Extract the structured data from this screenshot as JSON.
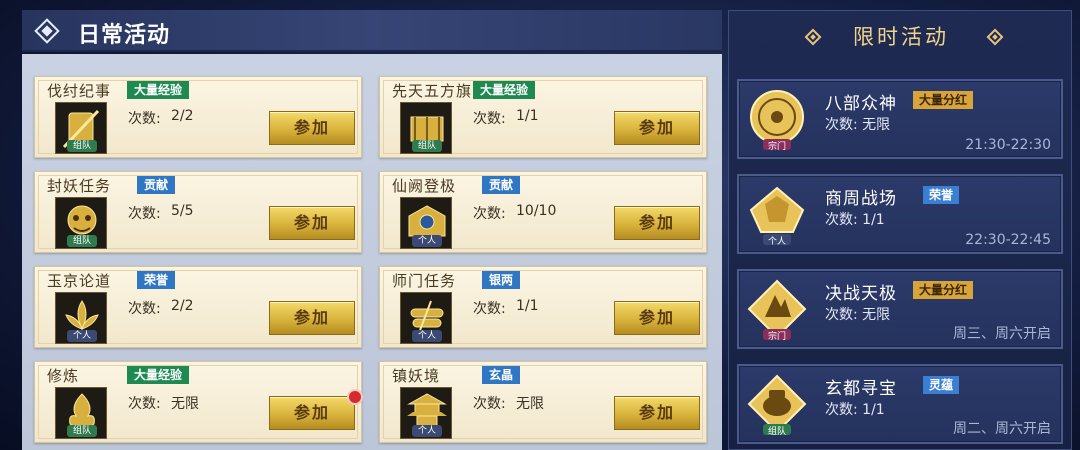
{
  "left_panel": {
    "title": "日常活动",
    "count_label": "次数:",
    "join_label": "参加",
    "activities": [
      {
        "name": "伐纣纪事",
        "tag": "大量经验",
        "tag_color": "green",
        "count": "2/2",
        "badge": "组队",
        "icon": "scroll-sword-icon"
      },
      {
        "name": "先天五方旗",
        "tag": "大量经验",
        "tag_color": "green",
        "count": "1/1",
        "badge": "组队",
        "icon": "flag-bundle-icon"
      },
      {
        "name": "封妖任务",
        "tag": "贡献",
        "tag_color": "blue",
        "count": "5/5",
        "badge": "组队",
        "icon": "demon-mask-icon"
      },
      {
        "name": "仙阙登极",
        "tag": "贡献",
        "tag_color": "blue",
        "count": "10/10",
        "badge": "个人",
        "icon": "celestial-gate-icon"
      },
      {
        "name": "玉京论道",
        "tag": "荣誉",
        "tag_color": "blue",
        "count": "2/2",
        "badge": "个人",
        "icon": "lotus-crest-icon"
      },
      {
        "name": "师门任务",
        "tag": "银两",
        "tag_color": "blue",
        "count": "1/1",
        "badge": "个人",
        "icon": "scroll-bundle-icon"
      },
      {
        "name": "修炼",
        "tag": "大量经验",
        "tag_color": "green",
        "count": "无限",
        "badge": "组队",
        "icon": "flame-crest-icon",
        "notify": true
      },
      {
        "name": "镇妖境",
        "tag": "玄晶",
        "tag_color": "blue",
        "count": "无限",
        "badge": "个人",
        "icon": "pagoda-icon"
      }
    ]
  },
  "right_panel": {
    "title": "限时活动",
    "count_label": "次数:",
    "events": [
      {
        "name": "八部众神",
        "tag": "大量分红",
        "tag_color": "gold",
        "count": "无限",
        "badge": "宗门",
        "time": "21:30-22:30",
        "icon": "round-crest-icon"
      },
      {
        "name": "商周战场",
        "tag": "荣誉",
        "tag_color": "blue",
        "count": "1/1",
        "badge": "个人",
        "time": "22:30-22:45",
        "icon": "battle-banner-icon"
      },
      {
        "name": "决战天极",
        "tag": "大量分红",
        "tag_color": "gold",
        "count": "无限",
        "badge": "宗门",
        "time": "周三、周六开启",
        "icon": "peak-crest-icon"
      },
      {
        "name": "玄都寻宝",
        "tag": "灵蕴",
        "tag_color": "blue",
        "count": "1/1",
        "badge": "组队",
        "time": "周二、周六开启",
        "icon": "treasure-pot-icon"
      }
    ]
  },
  "colors": {
    "accent_gold": "#d8b33c",
    "tag_green": "#1e8a52",
    "tag_blue": "#2f77c5",
    "tag_gold": "#d8a53a"
  }
}
